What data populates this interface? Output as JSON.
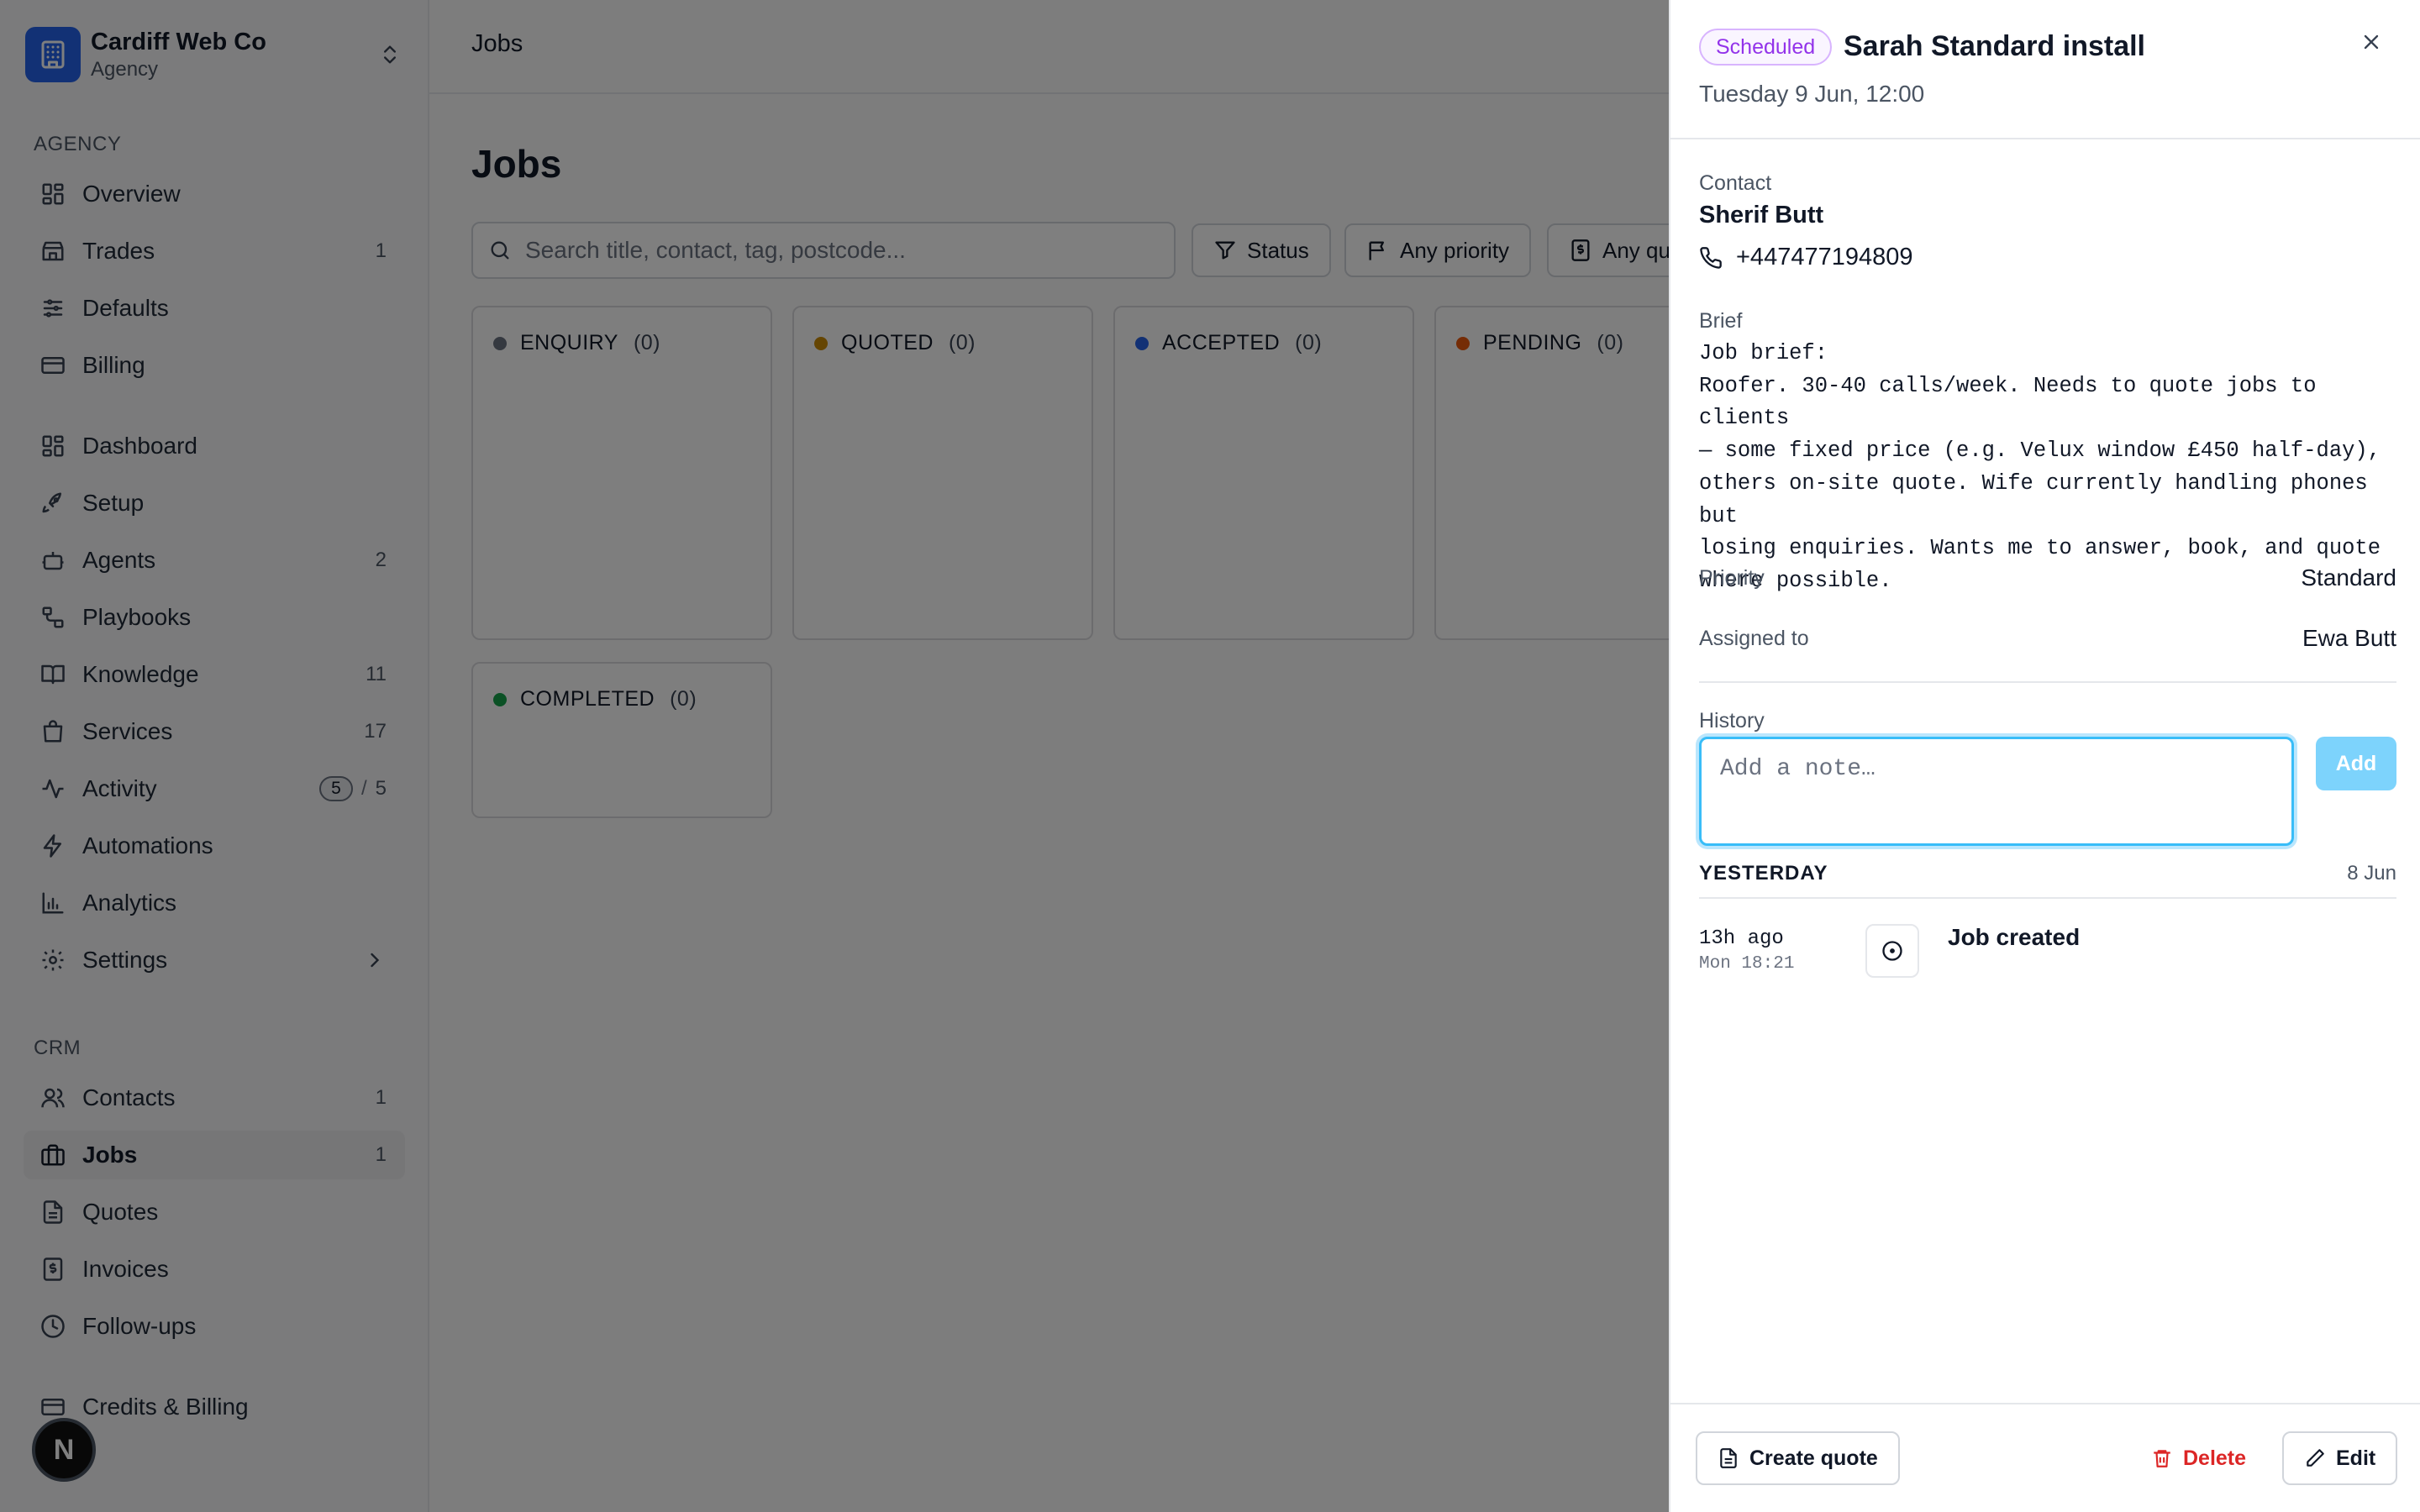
{
  "workspace": {
    "name": "Cardiff Web Co",
    "subtitle": "Agency"
  },
  "sidebar": {
    "agency_label": "AGENCY",
    "agency_items": [
      {
        "label": "Overview",
        "icon": "grid-icon",
        "count": ""
      },
      {
        "label": "Trades",
        "icon": "store-icon",
        "count": "1"
      },
      {
        "label": "Defaults",
        "icon": "sliders-icon",
        "count": ""
      },
      {
        "label": "Billing",
        "icon": "card-icon",
        "count": ""
      }
    ],
    "main_items": [
      {
        "label": "Dashboard",
        "icon": "grid-icon",
        "count": ""
      },
      {
        "label": "Setup",
        "icon": "rocket-icon",
        "count": ""
      },
      {
        "label": "Agents",
        "icon": "bot-icon",
        "count": "2"
      },
      {
        "label": "Playbooks",
        "icon": "workflow-icon",
        "count": ""
      },
      {
        "label": "Knowledge",
        "icon": "book-icon",
        "count": "11"
      },
      {
        "label": "Services",
        "icon": "bag-icon",
        "count": "17"
      },
      {
        "label": "Activity",
        "icon": "pulse-icon",
        "badge": "5",
        "count": "5"
      },
      {
        "label": "Automations",
        "icon": "bolt-icon",
        "count": ""
      },
      {
        "label": "Analytics",
        "icon": "bar-chart-icon",
        "count": ""
      },
      {
        "label": "Settings",
        "icon": "gear-icon",
        "count": ""
      }
    ],
    "crm_label": "CRM",
    "crm_items": [
      {
        "label": "Contacts",
        "icon": "users-icon",
        "count": "1"
      },
      {
        "label": "Jobs",
        "icon": "briefcase-icon",
        "count": "1"
      },
      {
        "label": "Quotes",
        "icon": "file-icon",
        "count": ""
      },
      {
        "label": "Invoices",
        "icon": "receipt-icon",
        "count": ""
      },
      {
        "label": "Follow-ups",
        "icon": "clock-icon",
        "count": ""
      }
    ],
    "credits_label": "Credits & Billing",
    "fab_label": "N"
  },
  "main": {
    "breadcrumb": "Jobs",
    "title": "Jobs",
    "search_placeholder": "Search title, contact, tag, postcode...",
    "filters": {
      "status": "Status",
      "priority": "Any priority",
      "quote": "Any qu"
    },
    "columns": [
      {
        "name": "ENQUIRY",
        "count": "(0)",
        "color": "#6b7280"
      },
      {
        "name": "QUOTED",
        "count": "(0)",
        "color": "#ca8a04"
      },
      {
        "name": "ACCEPTED",
        "count": "(0)",
        "color": "#2563eb"
      },
      {
        "name": "PENDING",
        "count": "(0)",
        "color": "#ea580c"
      },
      {
        "name": "COMPLETED",
        "count": "(0)",
        "color": "#16a34a"
      }
    ]
  },
  "drawer": {
    "status": "Scheduled",
    "title": "Sarah Standard install",
    "date": "Tuesday 9 Jun, 12:00",
    "contact_label": "Contact",
    "contact_name": "Sherif Butt",
    "phone": "+447477194809",
    "brief_label": "Brief",
    "brief_text": "Job brief:\nRoofer. 30-40 calls/week. Needs to quote jobs to clients\n— some fixed price (e.g. Velux window £450 half-day),\nothers on-site quote. Wife currently handling phones but\nlosing enquiries. Wants me to answer, book, and quote\nwhere possible.",
    "priority_label": "Priority",
    "priority_value": "Standard",
    "assigned_label": "Assigned to",
    "assigned_value": "Ewa Butt",
    "history_label": "History",
    "note_placeholder": "Add a note…",
    "add_label": "Add",
    "group_label": "YESTERDAY",
    "group_date": "8 Jun",
    "history": [
      {
        "rel": "13h ago",
        "abs": "Mon 18:21",
        "text": "Job created"
      }
    ],
    "footer": {
      "create_quote": "Create quote",
      "delete": "Delete",
      "edit": "Edit"
    }
  }
}
